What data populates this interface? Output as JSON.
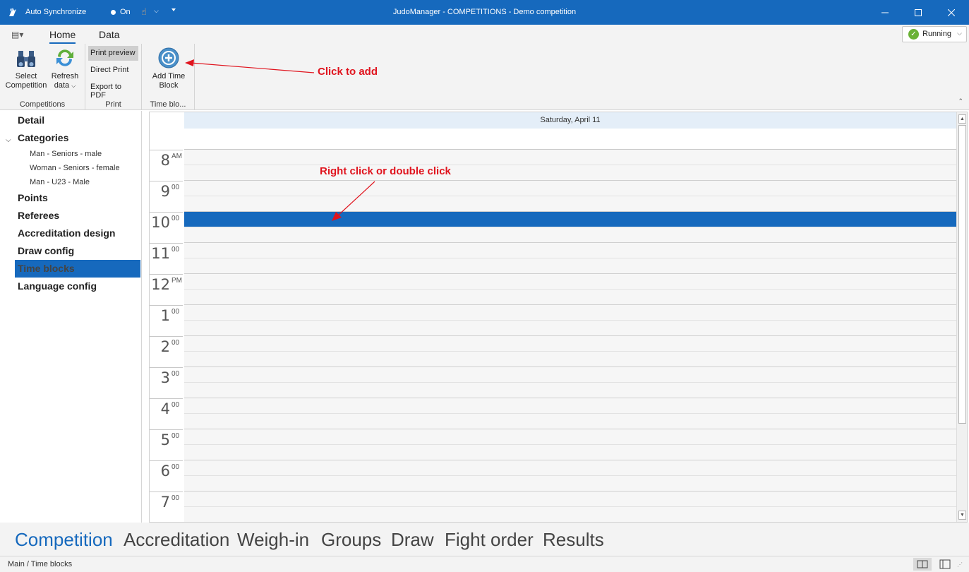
{
  "titlebar": {
    "sync_label": "Auto Synchronize",
    "on_label": "On",
    "title": "JudoManager - COMPETITIONS - Demo competition"
  },
  "ribbon_tabs": {
    "home": "Home",
    "data": "Data",
    "status_label": "Running"
  },
  "ribbon": {
    "competitions": {
      "label": "Competitions",
      "select_line1": "Select",
      "select_line2": "Competition",
      "refresh_line1": "Refresh",
      "refresh_line2": "data"
    },
    "print": {
      "label": "Print",
      "preview": "Print preview",
      "direct": "Direct Print",
      "pdf": "Export to PDF"
    },
    "timeblocks": {
      "label": "Time blo...",
      "add_line1": "Add Time",
      "add_line2": "Block"
    }
  },
  "leftnav": {
    "detail": "Detail",
    "categories": "Categories",
    "category_items": [
      "Man - Seniors - male",
      "Woman - Seniors - female",
      "Man - U23 - Male"
    ],
    "points": "Points",
    "referees": "Referees",
    "accreditation": "Accreditation design",
    "draw": "Draw config",
    "timeblocks": "Time blocks",
    "language": "Language config"
  },
  "scheduler": {
    "date_header": "Saturday, April 11",
    "hours": [
      {
        "h": "8",
        "m": "AM"
      },
      {
        "h": "9",
        "m": "00"
      },
      {
        "h": "10",
        "m": "00"
      },
      {
        "h": "11",
        "m": "00"
      },
      {
        "h": "12",
        "m": "PM"
      },
      {
        "h": "1",
        "m": "00"
      },
      {
        "h": "2",
        "m": "00"
      },
      {
        "h": "3",
        "m": "00"
      },
      {
        "h": "4",
        "m": "00"
      },
      {
        "h": "5",
        "m": "00"
      },
      {
        "h": "6",
        "m": "00"
      },
      {
        "h": "7",
        "m": "00"
      }
    ],
    "selected_slot": "10:00"
  },
  "annotations": {
    "add_note": "Click to add",
    "click_note": "Right click or double click"
  },
  "modules": [
    "Competition",
    "Accreditation",
    "Weigh-in",
    "Groups",
    "Draw",
    "Fight order",
    "Results"
  ],
  "statusbar": {
    "path": "Main / Time blocks"
  },
  "colors": {
    "accent": "#1669bd",
    "annotation": "#e0141e",
    "running": "#6ab236"
  }
}
